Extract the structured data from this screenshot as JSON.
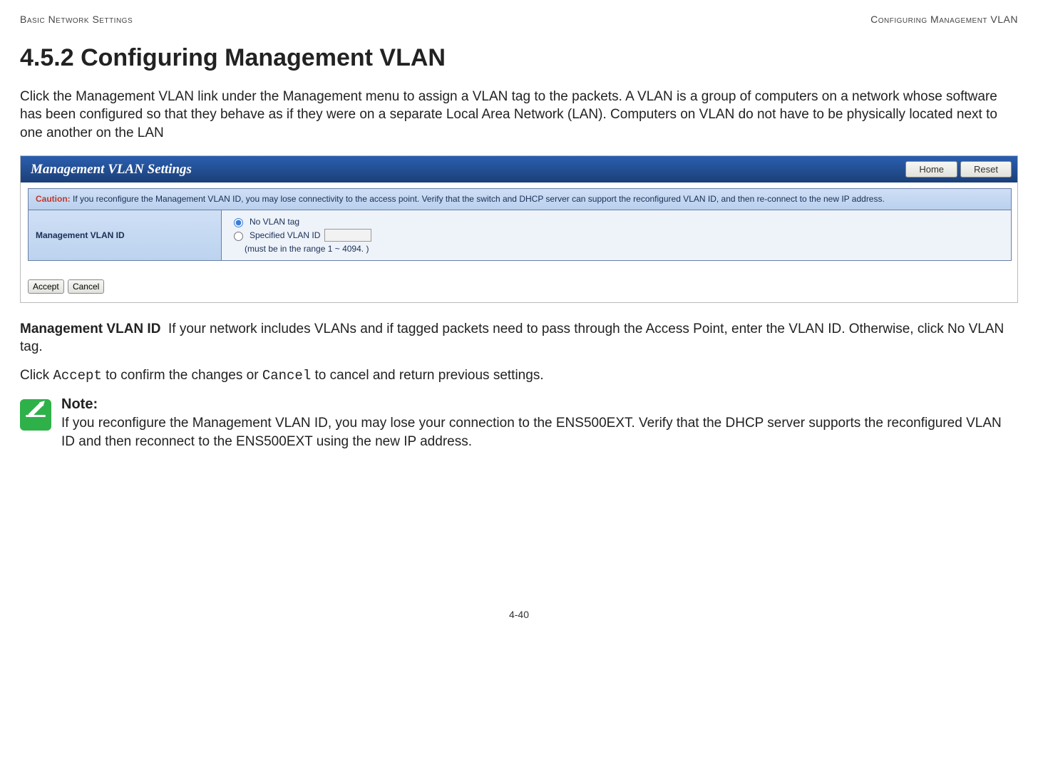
{
  "header": {
    "left": "Basic Network Settings",
    "right": "Configuring Management VLAN"
  },
  "title": "4.5.2 Configuring Management VLAN",
  "intro": "Click the Management VLAN link under the Management menu to assign a VLAN tag to the packets. A VLAN is a group of computers on a network whose software has been configured so that they behave as if they were on a separate Local Area Network (LAN). Computers on VLAN do not have to be physically located next to one another on the LAN",
  "ss": {
    "title": "Management VLAN Settings",
    "btn_home": "Home",
    "btn_reset": "Reset",
    "caution_label": "Caution:",
    "caution_text": " If you reconfigure the Management VLAN ID, you may lose connectivity to the access point. Verify that the switch and DHCP server can support the reconfigured VLAN ID, and then re-connect to the new IP address.",
    "row_label": "Management VLAN ID",
    "opt_novlan": "No VLAN tag",
    "opt_spec": "Specified VLAN ID",
    "hint": "(must be in the range 1 ~ 4094. )",
    "btn_accept": "Accept",
    "btn_cancel": "Cancel"
  },
  "mvlan": {
    "label": "Management VLAN ID",
    "desc": "If your network includes VLANs and if tagged packets need to pass through the Access Point, enter the VLAN ID. Otherwise, click No VLAN tag."
  },
  "confirm": {
    "pre": "Click ",
    "accept": "Accept",
    "mid": " to confirm the changes or ",
    "cancel": "Cancel",
    "post": " to cancel and return previous settings."
  },
  "note": {
    "label": "Note:",
    "text": "If you reconfigure the Management VLAN ID, you may lose your connection to the ENS500EXT. Verify that the DHCP server supports the reconfigured VLAN ID and then reconnect to the ENS500EXT using the new IP address."
  },
  "page_number": "4-40"
}
